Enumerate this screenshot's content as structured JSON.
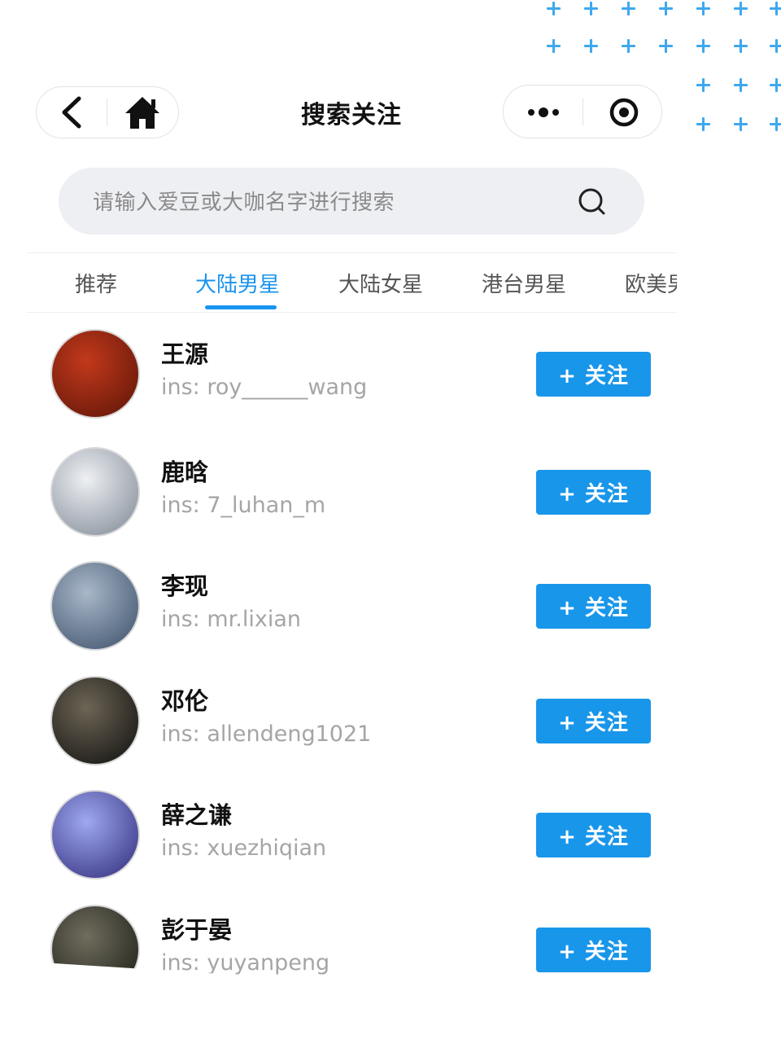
{
  "header": {
    "title": "搜索关注",
    "back_icon": "chevron-left-icon",
    "home_icon": "home-icon",
    "more_icon": "more-dots-icon",
    "target_icon": "target-icon"
  },
  "search": {
    "placeholder": "请输入爱豆或大咖名字进行搜索",
    "icon": "search-icon"
  },
  "tabs": [
    {
      "label": "推荐",
      "active": false
    },
    {
      "label": "大陆男星",
      "active": true
    },
    {
      "label": "大陆女星",
      "active": false
    },
    {
      "label": "港台男星",
      "active": false
    },
    {
      "label": "欧美男星",
      "active": false
    }
  ],
  "people": [
    {
      "name": "王源",
      "ins": "ins: roy______wang",
      "follow_label": "+ 关注",
      "avatar_colors": [
        "#c2391b",
        "#5b1408"
      ]
    },
    {
      "name": "鹿晗",
      "ins": "ins: 7_luhan_m",
      "follow_label": "+ 关注",
      "avatar_colors": [
        "#eef0f3",
        "#7d8794"
      ]
    },
    {
      "name": "李现",
      "ins": "ins: mr.lixian",
      "follow_label": "+ 关注",
      "avatar_colors": [
        "#a9b7c9",
        "#3a4f68"
      ]
    },
    {
      "name": "邓伦",
      "ins": "ins: allendeng1021",
      "follow_label": "+ 关注",
      "avatar_colors": [
        "#6d6555",
        "#0e0e0e"
      ]
    },
    {
      "name": "薛之谦",
      "ins": "ins: xuezhiqian",
      "follow_label": "+ 关注",
      "avatar_colors": [
        "#9ea8f0",
        "#2f2a7a"
      ]
    },
    {
      "name": "彭于晏",
      "ins": "ins: yuyanpeng",
      "follow_label": "+ 关注",
      "avatar_colors": [
        "#6f6d5d",
        "#1a1a14"
      ]
    }
  ],
  "colors": {
    "accent": "#1a94ee",
    "button": "#1896ea",
    "decor_plus": "#3fa8ee"
  }
}
